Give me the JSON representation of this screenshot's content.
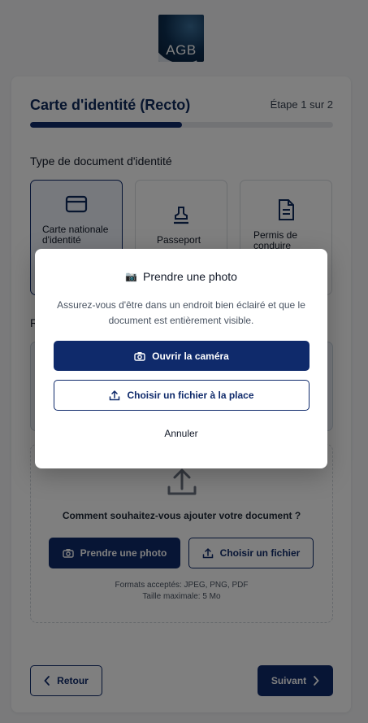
{
  "logo": {
    "text": "AGB"
  },
  "header": {
    "title": "Carte d'identité (Recto)",
    "step": "Étape 1 sur 2",
    "progress": 0.5
  },
  "doc_type": {
    "title": "Type de document d'identité",
    "options": [
      {
        "label": "Carte nationale d'identité",
        "icon": "id-card-icon",
        "selected": true
      },
      {
        "label": "Passeport",
        "icon": "stamp-icon",
        "selected": false
      },
      {
        "label": "Permis de conduire",
        "icon": "document-icon",
        "selected": false
      }
    ]
  },
  "recto": {
    "title": "R"
  },
  "upload": {
    "question": "Comment souhaitez-vous ajouter votre document ?",
    "take_photo": "Prendre une photo",
    "choose_file": "Choisir un fichier",
    "formats": "Formats acceptés: JPEG, PNG, PDF",
    "max_size": "Taille maximale: 5 Mo"
  },
  "nav": {
    "back": "Retour",
    "next": "Suivant"
  },
  "modal": {
    "icon": "📷",
    "title": "Prendre une photo",
    "description": "Assurez-vous d'être dans un endroit bien éclairé et que le document est entièrement visible.",
    "open_camera": "Ouvrir la caméra",
    "choose_file_instead": "Choisir un fichier à la place",
    "cancel": "Annuler"
  },
  "colors": {
    "primary": "#0f2a6b",
    "overlay": "rgba(0,0,0,0.5)"
  }
}
